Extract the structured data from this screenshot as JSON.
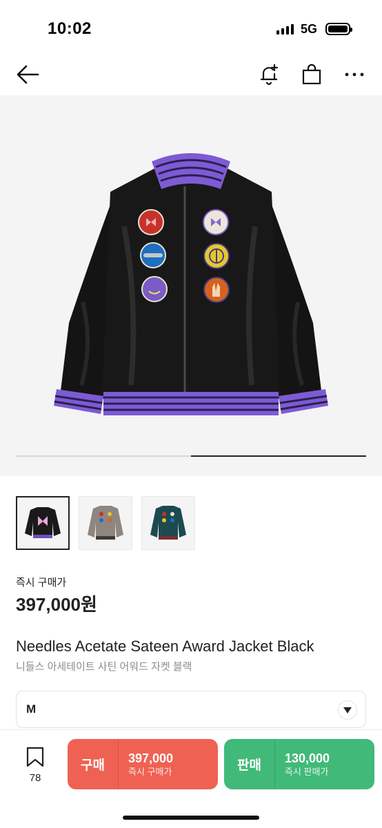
{
  "status": {
    "time": "10:02",
    "network": "5G"
  },
  "nav": {
    "back_icon": "arrow-left-icon",
    "alert_icon": "bell-plus-icon",
    "bag_icon": "shopping-bag-icon",
    "more_icon": "more-horizontal-icon"
  },
  "gallery": {
    "progress": 0.5,
    "thumb_count": 3,
    "active_thumb": 0
  },
  "price": {
    "label": "즉시 구매가",
    "value": "397,000원"
  },
  "product": {
    "title_en": "Needles Acetate Sateen Award Jacket Black",
    "title_ko": "니들스 아세테이트 사틴 어워드 자켓 블랙"
  },
  "size": {
    "selected": "M"
  },
  "bottom": {
    "wish_count": "78",
    "buy": {
      "label": "구매",
      "price": "397,000",
      "sub": "즉시 구매가"
    },
    "sell": {
      "label": "판매",
      "price": "130,000",
      "sub": "즉시 판매가"
    }
  },
  "colors": {
    "buy": "#ef6253",
    "sell": "#41b979",
    "jacket_trim": "#7d5bd4"
  }
}
